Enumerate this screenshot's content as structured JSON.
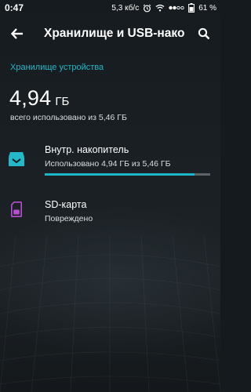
{
  "status_bar": {
    "time": "0:47",
    "speed": "5,3 кб/с",
    "battery": "61 %"
  },
  "toolbar": {
    "title": "Хранилище и USB-накопители"
  },
  "section": {
    "header": "Хранилище устройства",
    "used_value": "4,94",
    "used_unit": "ГБ",
    "used_subtitle": "всего использовано из 5,46 ГБ"
  },
  "storage_items": [
    {
      "title": "Внутр. накопитель",
      "subtitle": "Использовано 4,94 ГБ из 5,46 ГБ",
      "used_fraction": 0.905,
      "icon": "internal-storage-icon",
      "icon_color": "#26b7c9"
    },
    {
      "title": "SD-карта",
      "subtitle": "Повреждено",
      "icon": "sd-card-icon",
      "icon_color": "#b64fd1"
    }
  ],
  "colors": {
    "accent": "#26b7c9",
    "progress_track": "#5c6368",
    "background": "#181d21"
  }
}
